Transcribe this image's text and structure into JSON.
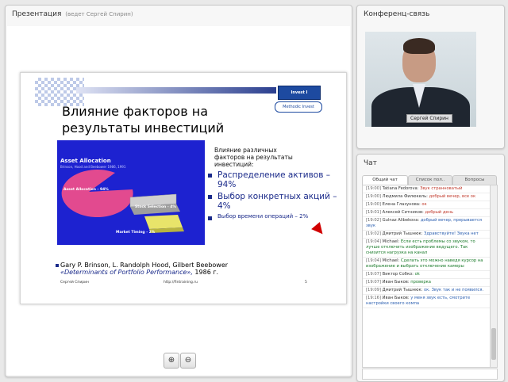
{
  "presentation": {
    "title": "Презентация",
    "subtitle": "(ведет Сергей Спирин)"
  },
  "slide": {
    "logo_badge": "Invest I",
    "logo_name": "Methodic Invest",
    "title_line1": "Влияние факторов на",
    "title_line2": "результаты инвестиций",
    "chart_title": "Asset Allocation",
    "chart_subtitle": "Brinson, Hood and Beebower 1986, 1991",
    "label_asset": "Asset Allocation - 94%",
    "label_stock": "Stock Selection - 4%",
    "label_market": "Market Timing - 2%",
    "intro_text": "Влияние различных факторов на результаты инвестиций:",
    "bullet1": "Распределение активов – 94%",
    "bullet2": "Выбор конкретных акций – 4%",
    "bullet3": "Выбор времени операций – 2%",
    "refs_line1": "Gary P. Brinson, L. Randolph Hood, Gilbert Beebower",
    "refs_line2": "«Determinants of Portfolio Performance»,",
    "refs_line2b": " 1986 г.",
    "footer_left": "Сергей Спирин",
    "footer_center": "http://fintraining.ru",
    "footer_right": "5"
  },
  "zoom": {
    "in_icon": "⊕",
    "out_icon": "⊖"
  },
  "conference": {
    "title": "Конференц-связь",
    "video_name": "Сергей Спирин"
  },
  "chat": {
    "title": "Чат",
    "tabs": [
      "Общий чат",
      "Список пол..",
      "Вопросы"
    ],
    "messages": [
      {
        "time": "[19:00]",
        "author": "Tatiana Fedorova:",
        "text": "Звук странноватый",
        "color": "red"
      },
      {
        "time": "[19:00]",
        "author": "Людмила Филюкель:",
        "text": "добрый вечер, все ок",
        "color": "red"
      },
      {
        "time": "[19:00]",
        "author": "Елена Глазунова:",
        "text": "ок",
        "color": "red"
      },
      {
        "time": "[19:01]",
        "author": "Алексей Ситников:",
        "text": "добрый день",
        "color": "red"
      },
      {
        "time": "[19:02]",
        "author": "Gulnaz Alibekova:",
        "text": "добрый вечер, прерывается звук",
        "color": "blue"
      },
      {
        "time": "[19:02]",
        "author": "Дмитрий Тышнюк:",
        "text": "Здравствуйте! Звука нет",
        "color": "blue"
      },
      {
        "time": "[19:04]",
        "author": "Michael:",
        "text": "Если есть проблемы со звуком, то лучше отключить изображение ведущего. Так снизится нагрузка на канал",
        "color": "green"
      },
      {
        "time": "[19:04]",
        "author": "Michael:",
        "text": "Сделать это можно наведя курсор на изображение и выбрать отключение камеры",
        "color": "green"
      },
      {
        "time": "[19:07]",
        "author": "Виктор Собко:",
        "text": "ok",
        "color": "green"
      },
      {
        "time": "[19:07]",
        "author": "Иван Быков:",
        "text": "проверка",
        "color": "green"
      },
      {
        "time": "[19:09]",
        "author": "Дмитрий Тышнюк:",
        "text": "ок. Звук так и не появился.",
        "color": "blue"
      },
      {
        "time": "[19:16]",
        "author": "Иван Быков:",
        "text": "у меня звук есть, смотрите настройки своего компа",
        "color": "blue"
      }
    ]
  }
}
